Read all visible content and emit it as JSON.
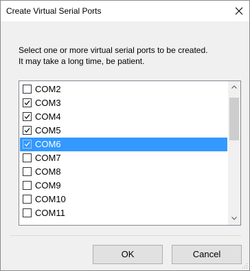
{
  "window": {
    "title": "Create Virtual Serial Ports"
  },
  "message": {
    "line1": "Select one or more virtual serial ports to be created.",
    "line2": "It may take a long time, be patient."
  },
  "ports": [
    {
      "label": "COM2",
      "checked": false,
      "selected": false
    },
    {
      "label": "COM3",
      "checked": true,
      "selected": false
    },
    {
      "label": "COM4",
      "checked": true,
      "selected": false
    },
    {
      "label": "COM5",
      "checked": true,
      "selected": false
    },
    {
      "label": "COM6",
      "checked": true,
      "selected": true
    },
    {
      "label": "COM7",
      "checked": false,
      "selected": false
    },
    {
      "label": "COM8",
      "checked": false,
      "selected": false
    },
    {
      "label": "COM9",
      "checked": false,
      "selected": false
    },
    {
      "label": "COM10",
      "checked": false,
      "selected": false
    },
    {
      "label": "COM11",
      "checked": false,
      "selected": false
    }
  ],
  "buttons": {
    "ok_label": "OK",
    "cancel_label": "Cancel"
  },
  "colors": {
    "selection": "#3399ff",
    "dialog_bg": "#f0f0f0",
    "button_bg": "#e1e1e1"
  },
  "icons": {
    "close": "close-icon",
    "scroll_up": "chevron-up-icon",
    "scroll_down": "chevron-down-icon",
    "checkbox": "checkmark-icon",
    "resize": "resize-grip-icon"
  }
}
